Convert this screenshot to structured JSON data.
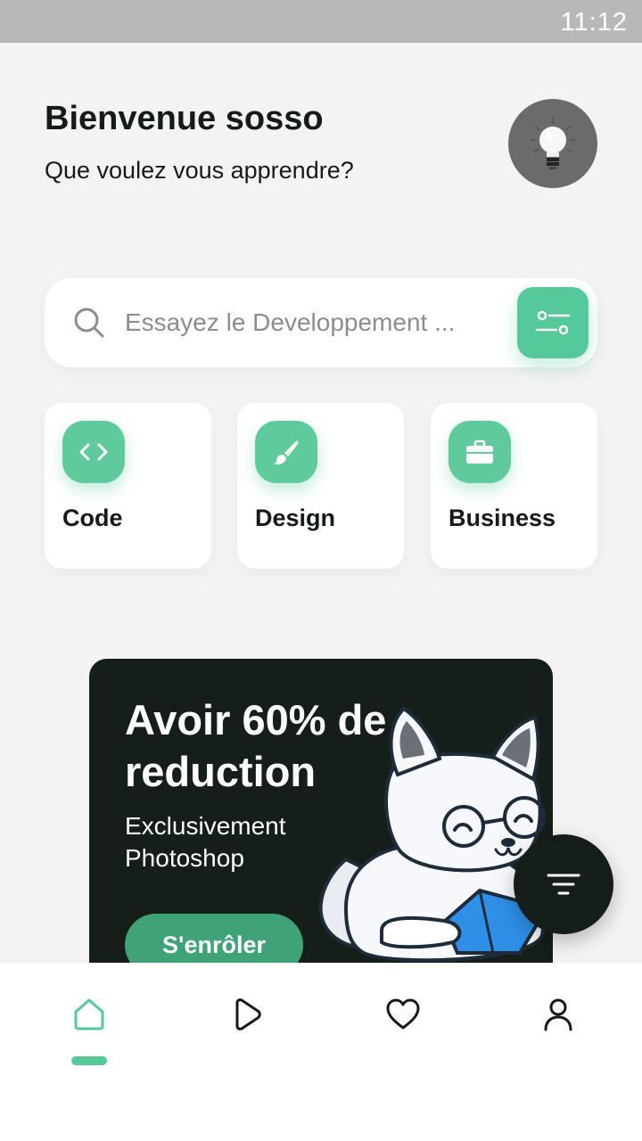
{
  "status_bar": {
    "time": "11:12"
  },
  "header": {
    "greeting": "Bienvenue sosso",
    "subtitle": "Que voulez vous apprendre?",
    "avatar_icon": "lightbulb-icon"
  },
  "search": {
    "placeholder": "Essayez le Developpement ...",
    "value": "",
    "search_icon": "search-icon",
    "filter_icon": "sliders-icon"
  },
  "categories": [
    {
      "label": "Code",
      "icon": "code-icon"
    },
    {
      "label": "Design",
      "icon": "brush-icon"
    },
    {
      "label": "Business",
      "icon": "briefcase-icon"
    }
  ],
  "promo": {
    "title": "Avoir 60% de reduction",
    "description": "Exclusivement Photoshop",
    "button_label": "S'enrôler",
    "illustration": "cat-mascot-reading"
  },
  "fab": {
    "icon": "filter-icon"
  },
  "bottom_nav": {
    "items": [
      {
        "icon": "home-icon",
        "active": true
      },
      {
        "icon": "play-icon",
        "active": false
      },
      {
        "icon": "heart-icon",
        "active": false
      },
      {
        "icon": "user-icon",
        "active": false
      }
    ]
  },
  "colors": {
    "accent": "#56c99a",
    "dark": "#151e19",
    "background": "#f3f3f3",
    "card": "#ffffff",
    "placeholder_text": "#8d8d8d"
  }
}
